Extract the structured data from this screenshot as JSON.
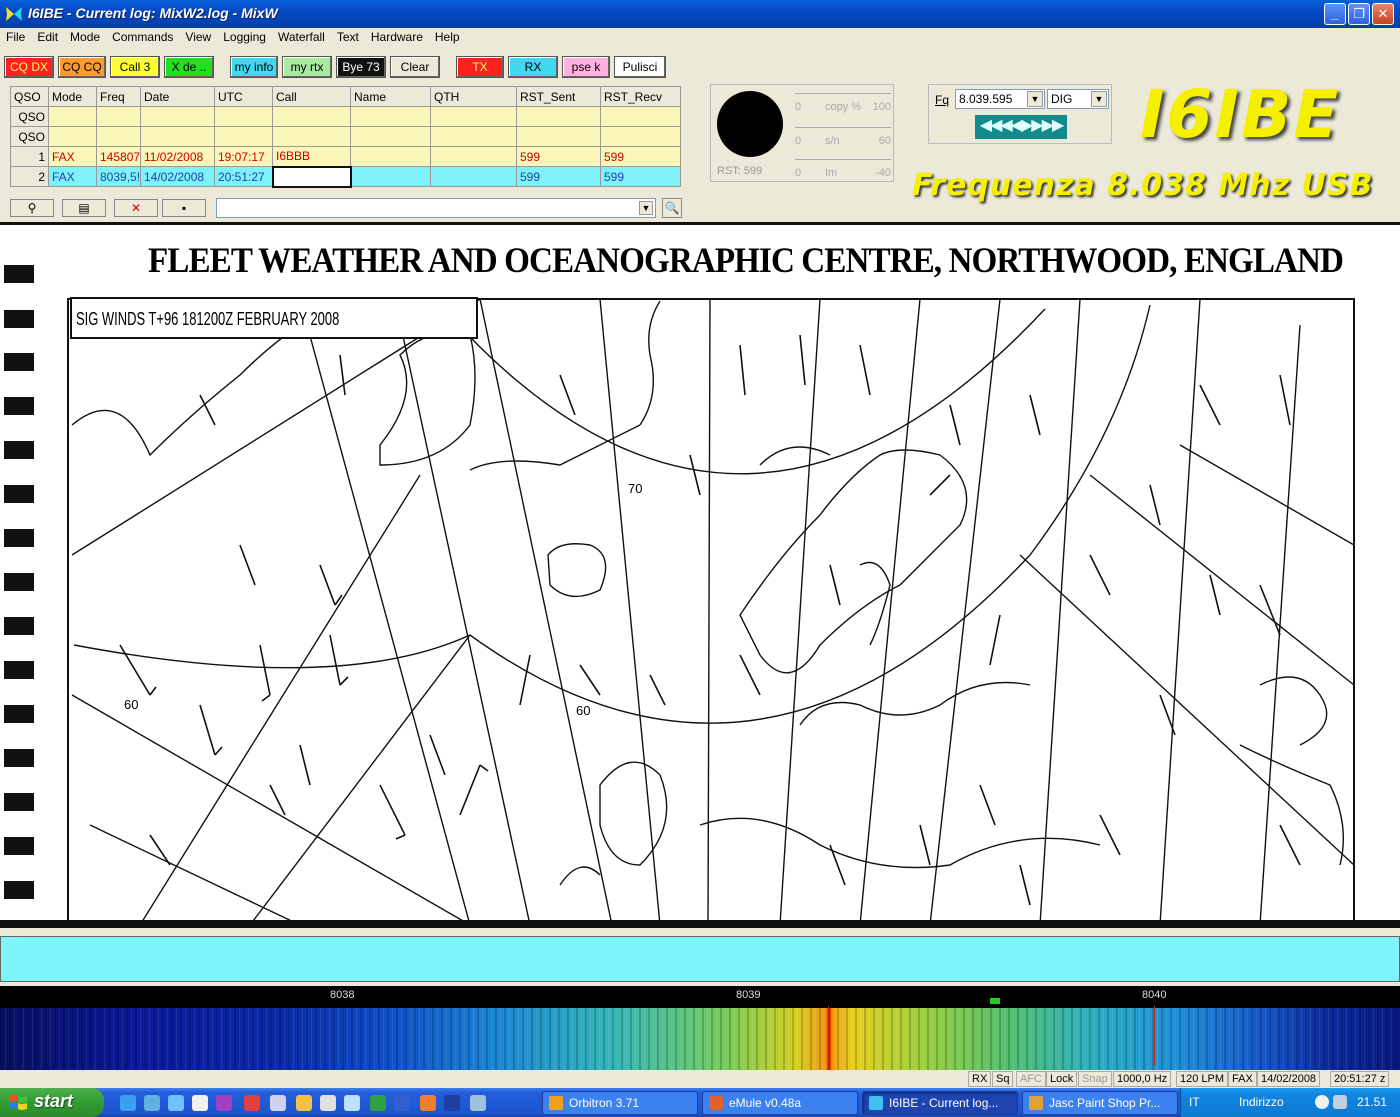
{
  "window": {
    "title": "I6IBE - Current log: MixW2.log - MixW",
    "min": "_",
    "max": "❐",
    "close": "✕"
  },
  "menu": [
    "File",
    "Edit",
    "Mode",
    "Commands",
    "View",
    "Logging",
    "Waterfall",
    "Text",
    "Hardware",
    "Help"
  ],
  "macros": [
    {
      "label": "CQ DX",
      "bg": "#ff2020",
      "fg": "#ffff60"
    },
    {
      "label": "CQ CQ",
      "bg": "#ff9a30",
      "fg": "#000000"
    },
    {
      "label": "Call 3",
      "bg": "#ffff30",
      "fg": "#000000"
    },
    {
      "label": "X de ..",
      "bg": "#20e020",
      "fg": "#000000"
    },
    {
      "label": "my info",
      "bg": "#40d8f0",
      "fg": "#000000"
    },
    {
      "label": "my rtx",
      "bg": "#a8e8a0",
      "fg": "#000000"
    },
    {
      "label": "Bye 73",
      "bg": "#101010",
      "fg": "#ffffff"
    },
    {
      "label": "Clear",
      "bg": "#ece9d8",
      "fg": "#000000"
    },
    {
      "label": "TX",
      "bg": "#ff2020",
      "fg": "#ffff60"
    },
    {
      "label": "RX",
      "bg": "#40d8f0",
      "fg": "#000000"
    },
    {
      "label": "pse k",
      "bg": "#ffb0e0",
      "fg": "#000000"
    },
    {
      "label": "Pulisci",
      "bg": "#ffffff",
      "fg": "#000000"
    }
  ],
  "log": {
    "columns": [
      "QSO",
      "Mode",
      "Freq",
      "Date",
      "UTC",
      "Call",
      "Name",
      "QTH",
      "RST_Sent",
      "RST_Recv"
    ],
    "rows": [
      {
        "qso": "QSO",
        "mode": "",
        "freq": "",
        "date": "",
        "utc": "",
        "call": "",
        "name": "",
        "qth": "",
        "sent": "",
        "recv": ""
      },
      {
        "qso": "QSO",
        "mode": "",
        "freq": "",
        "date": "",
        "utc": "",
        "call": "",
        "name": "",
        "qth": "",
        "sent": "",
        "recv": ""
      },
      {
        "qso": "1",
        "mode": "FAX",
        "freq": "145807",
        "date": "11/02/2008",
        "utc": "19:07:17",
        "call": "I6BBB",
        "name": "",
        "qth": "",
        "sent": "599",
        "recv": "599"
      },
      {
        "qso": "2",
        "mode": "FAX",
        "freq": "8039,5!",
        "date": "14/02/2008",
        "utc": "20:51:27",
        "call": "",
        "name": "",
        "qth": "",
        "sent": "599",
        "recv": "599"
      }
    ]
  },
  "toolbar": {
    "search_value": "",
    "find_icon": "🔍"
  },
  "meter": {
    "rst": "RST: 599",
    "row1": {
      "l": "0",
      "m": "copy %",
      "r": "100"
    },
    "row2": {
      "l": "0",
      "m": "s/n",
      "r": "60"
    },
    "row3": {
      "l": "0",
      "m": "Im",
      "r": "-40"
    }
  },
  "freq": {
    "label": "Fq",
    "value": "8.039.595",
    "mode": "DIG",
    "tune": "◀◀◀◀▶▶▶▶"
  },
  "banner": {
    "callsign": "I6IBE",
    "frequency": "Frequenza 8.038 Mhz USB"
  },
  "fax": {
    "title": "FLEET WEATHER AND OCEANOGRAPHIC CENTRE, NORTHWOOD, ENGLAND",
    "chart_label": "SIG WINDS T+96 181200Z FEBRUARY 2008",
    "lat_70": "70",
    "lat_60": "60",
    "lat_60b": "60"
  },
  "waterfall": {
    "scale": [
      "8038",
      "8039",
      "8040"
    ]
  },
  "status": {
    "items": [
      {
        "t": "RX",
        "dim": false
      },
      {
        "t": "Sq",
        "dim": false
      },
      {
        "t": "AFC",
        "dim": true
      },
      {
        "t": "Lock",
        "dim": false
      },
      {
        "t": "Snap",
        "dim": true
      },
      {
        "t": "1000,0 Hz",
        "dim": false
      },
      {
        "t": "120 LPM",
        "dim": false
      },
      {
        "t": "FAX",
        "dim": false
      },
      {
        "t": "14/02/2008",
        "dim": false
      },
      {
        "t": "20:51:27 z",
        "dim": false
      }
    ]
  },
  "taskbar": {
    "start": "start",
    "tasks": [
      {
        "label": "Orbitron 3.71",
        "color": "#f0a020",
        "active": false
      },
      {
        "label": "eMule v0.48a",
        "color": "#e06030",
        "active": false
      },
      {
        "label": "I6IBE - Current log...",
        "color": "#40c0f0",
        "active": true
      },
      {
        "label": "Jasc Paint Shop Pr...",
        "color": "#e0a040",
        "active": false
      }
    ],
    "lang": "IT",
    "address": "Indirizzo",
    "clock": "21.51"
  }
}
